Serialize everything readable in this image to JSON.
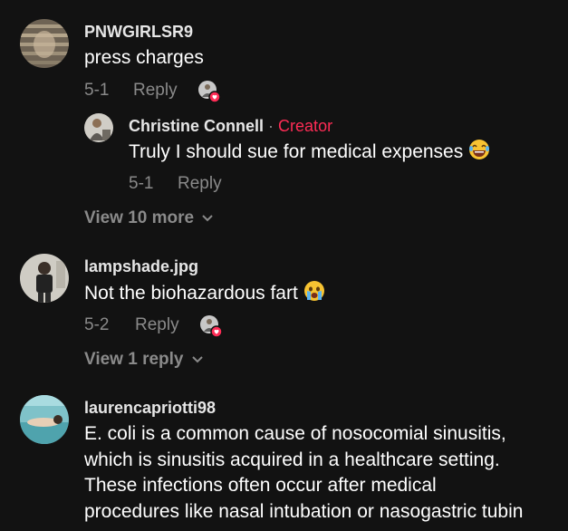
{
  "comments": [
    {
      "username": "PNWGIRLSR9",
      "text": "press charges",
      "date": "5-1",
      "reply_label": "Reply",
      "replies": [
        {
          "username": "Christine Connell",
          "separator": "·",
          "badge": "Creator",
          "text": "Truly I should sue for medical expenses",
          "emoji": "laughing-emoji",
          "date": "5-1",
          "reply_label": "Reply"
        }
      ],
      "view_more": "View 10 more"
    },
    {
      "username": "lampshade.jpg",
      "text": "Not the biohazardous fart",
      "emoji": "crying-emoji",
      "date": "5-2",
      "reply_label": "Reply",
      "view_more": "View 1 reply"
    },
    {
      "username": "laurencapriotti98",
      "text_lines": [
        "E. coli is a common cause of nosocomial sinusitis,",
        "which is sinusitis acquired in a healthcare setting.",
        "These infections often occur after medical",
        "procedures like nasal intubation or nasogastric tubin"
      ]
    }
  ],
  "colors": {
    "background": "#121212",
    "muted": "#8a8a8a",
    "creator": "#fe2c55"
  }
}
